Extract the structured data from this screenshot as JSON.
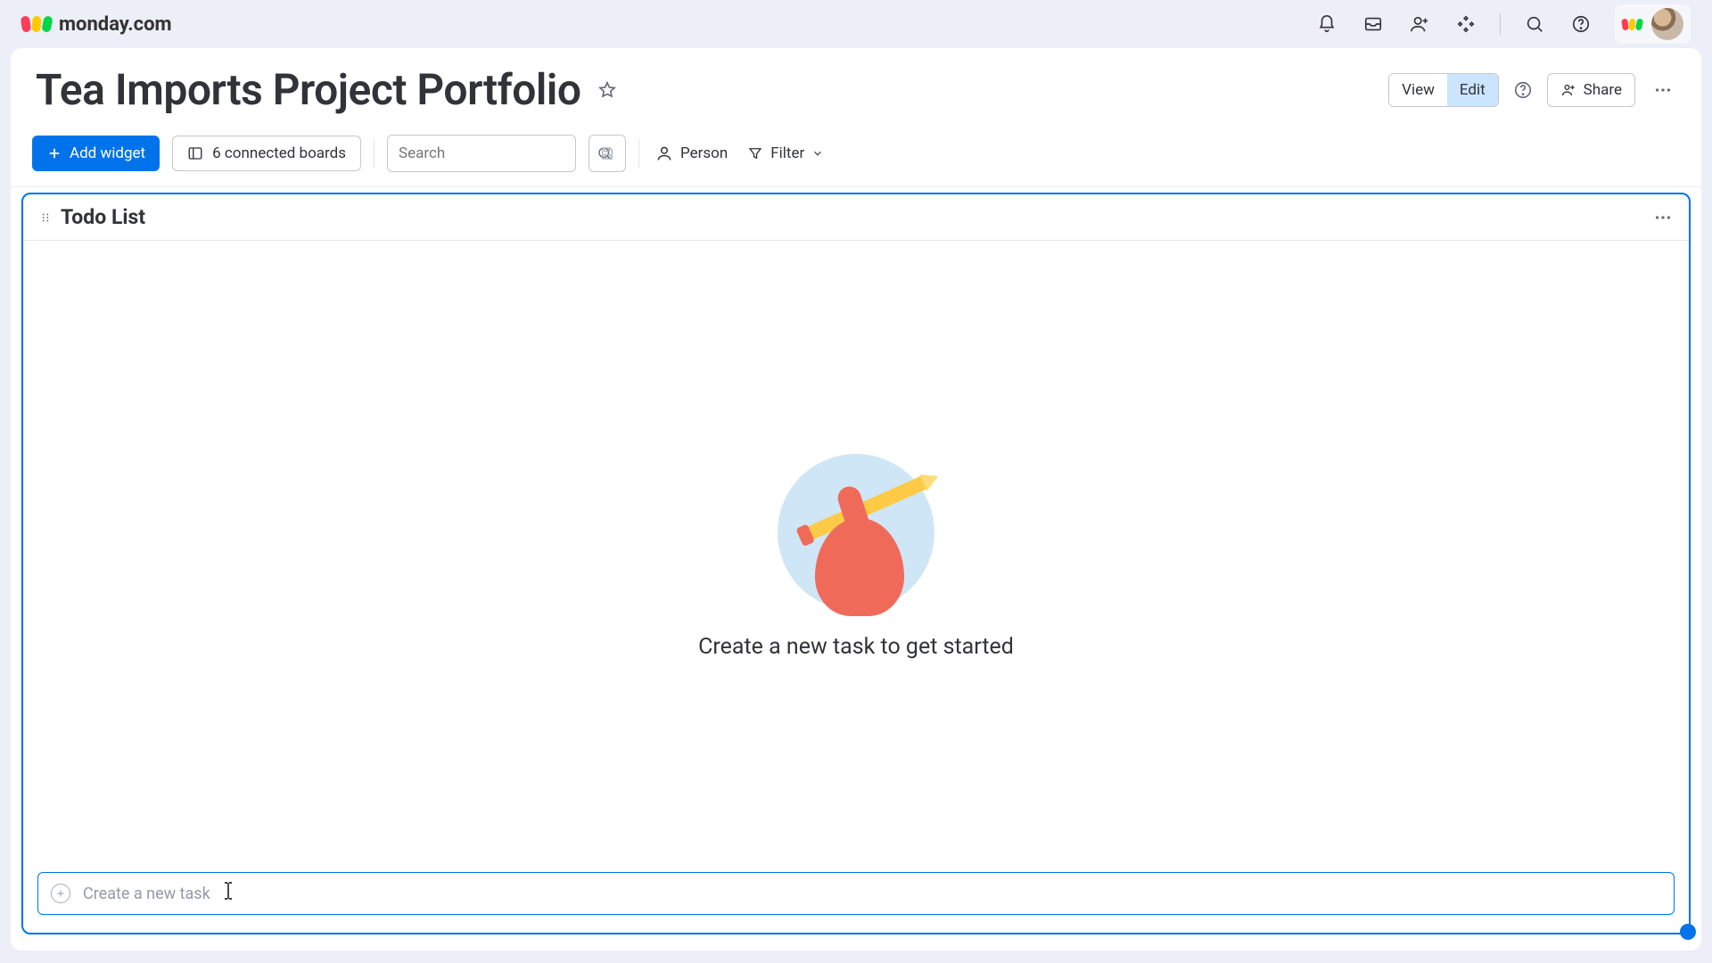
{
  "brand": {
    "name": "monday.com"
  },
  "header": {
    "title": "Tea Imports Project Portfolio",
    "view_label": "View",
    "edit_label": "Edit",
    "share_label": "Share"
  },
  "toolbar": {
    "add_widget_label": "Add widget",
    "connected_boards_label": "6 connected boards",
    "search_placeholder": "Search",
    "person_label": "Person",
    "filter_label": "Filter"
  },
  "widget": {
    "title": "Todo List",
    "empty_state_text": "Create a new task to get started",
    "new_task_placeholder": "Create a new task"
  }
}
